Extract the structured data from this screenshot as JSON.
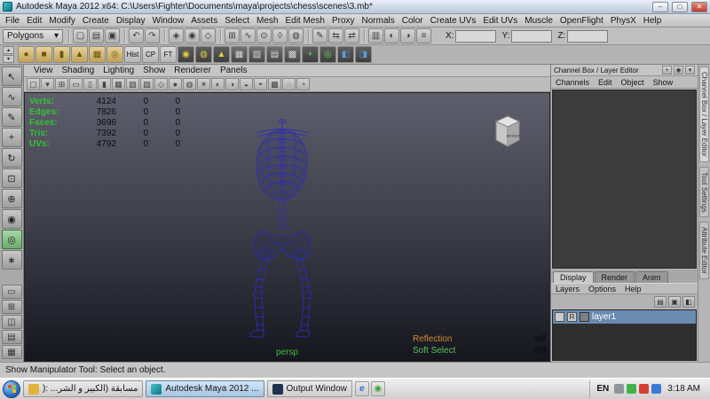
{
  "titlebar": {
    "title": "Autodesk Maya 2012 x64: C:\\Users\\Fighter\\Documents\\maya\\projects\\chess\\scenes\\3.mb*",
    "window_buttons": {
      "minimize": "–",
      "maximize": "□",
      "close": "✕"
    }
  },
  "menubar": {
    "items": [
      "File",
      "Edit",
      "Modify",
      "Create",
      "Display",
      "Window",
      "Assets",
      "Select",
      "Mesh",
      "Edit Mesh",
      "Proxy",
      "Normals",
      "Color",
      "Create UVs",
      "Edit UVs",
      "Muscle",
      "OpenFlight",
      "PhysX",
      "Help"
    ]
  },
  "statusline": {
    "mode_selector": "Polygons",
    "dropdown_arrow": "▾",
    "icons": [
      {
        "name": "new-scene-icon",
        "glyph": "▢",
        "cls": "gs"
      },
      {
        "name": "open-scene-icon",
        "glyph": "▤"
      },
      {
        "name": "save-scene-icon",
        "glyph": "▣"
      },
      {
        "name": "undo-icon",
        "glyph": "↶",
        "cls": "gs"
      },
      {
        "name": "redo-icon",
        "glyph": "↷"
      },
      {
        "name": "select-hierarchy-icon",
        "glyph": "◈",
        "cls": "gs"
      },
      {
        "name": "select-object-icon",
        "glyph": "◉"
      },
      {
        "name": "select-component-icon",
        "glyph": "◇"
      },
      {
        "name": "snap-to-grid-icon",
        "glyph": "⊞",
        "cls": "gs"
      },
      {
        "name": "snap-to-curve-icon",
        "glyph": "∿"
      },
      {
        "name": "snap-to-point-icon",
        "glyph": "⊙"
      },
      {
        "name": "snap-to-plane-icon",
        "glyph": "◊"
      },
      {
        "name": "make-live-icon",
        "glyph": "◍"
      },
      {
        "name": "construction-history-icon",
        "glyph": "✎",
        "cls": "gs"
      },
      {
        "name": "input-connections-icon",
        "glyph": "⇆"
      },
      {
        "name": "output-connections-icon",
        "glyph": "⇄"
      },
      {
        "name": "render-view-icon",
        "glyph": "▥",
        "cls": "gs"
      },
      {
        "name": "render-current-frame-icon",
        "glyph": "◐"
      },
      {
        "name": "ipr-render-icon",
        "glyph": "◑"
      },
      {
        "name": "render-settings-icon",
        "glyph": "≡"
      }
    ],
    "axis_fields": [
      {
        "label": "X:",
        "name": "x-coordinate-input"
      },
      {
        "label": "Y:",
        "name": "y-coordinate-input"
      },
      {
        "label": "Z:",
        "name": "z-coordinate-input"
      }
    ]
  },
  "shelf": {
    "tab_up": "▴",
    "tab_down": "▾",
    "icons": [
      {
        "name": "poly-sphere-icon",
        "glyph": "●",
        "cls": "tan"
      },
      {
        "name": "poly-cube-icon",
        "glyph": "■",
        "cls": "tan"
      },
      {
        "name": "poly-cylinder-icon",
        "glyph": "▮",
        "cls": "tan"
      },
      {
        "name": "poly-cone-icon",
        "glyph": "▲",
        "cls": "tan"
      },
      {
        "name": "poly-plane-icon",
        "glyph": "▦",
        "cls": "tan"
      },
      {
        "name": "poly-torus-icon",
        "glyph": "◎",
        "cls": "tan"
      },
      {
        "name": "history-toggle-button",
        "glyph": "Hist",
        "cls": "chip"
      },
      {
        "name": "cp-button",
        "glyph": "CP",
        "cls": "chip"
      },
      {
        "name": "ft-button",
        "glyph": "FT",
        "cls": "chip"
      },
      {
        "name": "sculpt-geometry-icon",
        "glyph": "◉",
        "cls": "yellow"
      },
      {
        "name": "smooth-mesh-icon",
        "glyph": "◍",
        "cls": "yellow"
      },
      {
        "name": "extrude-icon",
        "glyph": "▲",
        "cls": "yellow"
      },
      {
        "name": "combine-icon",
        "glyph": "▦",
        "cls": "dark"
      },
      {
        "name": "separate-icon",
        "glyph": "▧",
        "cls": "dark"
      },
      {
        "name": "merge-vertices-icon",
        "glyph": "▤",
        "cls": "dark"
      },
      {
        "name": "split-polygon-icon",
        "glyph": "▩",
        "cls": "dark"
      },
      {
        "name": "append-polygon-icon",
        "glyph": "+",
        "cls": "green"
      },
      {
        "name": "bridge-icon",
        "glyph": "◎",
        "cls": "green"
      },
      {
        "name": "mirror-geometry-icon",
        "glyph": "◧",
        "cls": "blue"
      },
      {
        "name": "boolean-icon",
        "glyph": "◨",
        "cls": "blue"
      }
    ]
  },
  "toolbox": {
    "tools": [
      {
        "name": "select-tool",
        "glyph": "↖"
      },
      {
        "name": "lasso-tool",
        "glyph": "∿"
      },
      {
        "name": "paint-select-tool",
        "glyph": "✎"
      },
      {
        "name": "move-tool",
        "glyph": "+"
      },
      {
        "name": "rotate-tool",
        "glyph": "↻"
      },
      {
        "name": "scale-tool",
        "glyph": "⊡"
      },
      {
        "name": "universal-manipulator-tool",
        "glyph": "⊕"
      },
      {
        "name": "soft-modification-tool",
        "glyph": "◉"
      },
      {
        "name": "show-manipulator-tool",
        "glyph": "◎",
        "cls": "active"
      },
      {
        "name": "last-tool-used",
        "glyph": "∗"
      }
    ],
    "layouts": [
      {
        "name": "single-pane-layout-button",
        "glyph": "▭"
      },
      {
        "name": "four-pane-layout-button",
        "glyph": "⊞"
      },
      {
        "name": "persp-outliner-layout-button",
        "glyph": "◫"
      },
      {
        "name": "persp-graph-layout-button",
        "glyph": "▤"
      },
      {
        "name": "hypershade-layout-button",
        "glyph": "▦"
      }
    ]
  },
  "panel": {
    "menu": [
      "View",
      "Shading",
      "Lighting",
      "Show",
      "Renderer",
      "Panels"
    ],
    "toolbar_icons": [
      {
        "name": "camera-attributes-icon",
        "glyph": "▢"
      },
      {
        "name": "bookmarks-icon",
        "glyph": "▾"
      },
      {
        "name": "grid-toggle-icon",
        "glyph": "⊞"
      },
      {
        "name": "film-gate-icon",
        "glyph": "▭"
      },
      {
        "name": "resolution-gate-icon",
        "glyph": "▯"
      },
      {
        "name": "gate-mask-icon",
        "glyph": "▮"
      },
      {
        "name": "field-chart-icon",
        "glyph": "▦"
      },
      {
        "name": "safe-action-icon",
        "glyph": "▧"
      },
      {
        "name": "safe-title-icon",
        "glyph": "▨"
      },
      {
        "name": "wireframe-mode-icon",
        "glyph": "◇"
      },
      {
        "name": "shaded-mode-icon",
        "glyph": "●"
      },
      {
        "name": "textured-mode-icon",
        "glyph": "◍"
      },
      {
        "name": "use-all-lights-icon",
        "glyph": "☀"
      },
      {
        "name": "shadows-icon",
        "glyph": "◐"
      },
      {
        "name": "xray-icon",
        "glyph": "◑"
      },
      {
        "name": "exposure-icon",
        "glyph": "◒"
      },
      {
        "name": "gamma-icon",
        "glyph": "◓"
      },
      {
        "name": "rgb-channels-icon",
        "glyph": "▩"
      },
      {
        "name": "alpha-channel-icon",
        "glyph": "◌"
      },
      {
        "name": "isolate-select-icon",
        "glyph": "◔"
      }
    ]
  },
  "hud": {
    "rows": [
      {
        "name": "hud-verts",
        "label": "Verts:",
        "value": "4124",
        "sel": "0",
        "other": "0"
      },
      {
        "name": "hud-edges",
        "label": "Edges:",
        "value": "7826",
        "sel": "0",
        "other": "0"
      },
      {
        "name": "hud-faces",
        "label": "Faces:",
        "value": "3696",
        "sel": "0",
        "other": "0"
      },
      {
        "name": "hud-tris",
        "label": "Tris:",
        "value": "7392",
        "sel": "0",
        "other": "0"
      },
      {
        "name": "hud-uvs",
        "label": "UVs:",
        "value": "4792",
        "sel": "0",
        "other": "0"
      }
    ]
  },
  "viewport": {
    "camera_label": "persp",
    "viewcube_face": "FRONT",
    "overlays": [
      {
        "name": "reflection-hud",
        "label": "Reflection",
        "value": "off",
        "cls": "ov1"
      },
      {
        "name": "soft-select-hud",
        "label": "Soft Select",
        "value": "off",
        "cls": "ov2"
      }
    ]
  },
  "channel_box": {
    "header": "Channel Box / Layer Editor",
    "header_icons": [
      {
        "name": "channel-manip-icon",
        "glyph": "+"
      },
      {
        "name": "channel-speed-icon",
        "glyph": "◉"
      },
      {
        "name": "channel-options-icon",
        "glyph": "▾"
      }
    ],
    "menu": [
      "Channels",
      "Edit",
      "Object",
      "Show"
    ]
  },
  "layer_editor": {
    "tabs": [
      {
        "label": "Display",
        "cls": "active"
      },
      {
        "label": "Render"
      },
      {
        "label": "Anim"
      }
    ],
    "menu": [
      "Layers",
      "Options",
      "Help"
    ],
    "icons": [
      {
        "name": "empty-layer-icon",
        "glyph": "▤"
      },
      {
        "name": "new-layer-icon",
        "glyph": "▣"
      },
      {
        "name": "new-layer-from-selected-icon",
        "glyph": "◧"
      }
    ],
    "layer": {
      "visibility": "",
      "mode": "R",
      "name": "layer1"
    }
  },
  "side_tabs": [
    {
      "label": "Channel Box / Layer Editor",
      "cls": "active"
    },
    {
      "label": "Tool Settings"
    },
    {
      "label": "Attribute Editor"
    }
  ],
  "help_line": "Show Manipulator Tool: Select an object.",
  "taskbar": {
    "tasks": [
      {
        "label": "مسابقة (الكبير و الشر... :(",
        "cls": "t1"
      },
      {
        "label": "Autodesk Maya 2012 ...",
        "cls": "t2 active"
      },
      {
        "label": "Output Window",
        "cls": "t3"
      }
    ],
    "quick_icons": [
      {
        "name": "internet-explorer-icon",
        "glyph": "e",
        "cls": "qblue"
      },
      {
        "name": "messenger-launcher-icon",
        "glyph": "◉",
        "cls": "qgreen"
      }
    ],
    "tray": {
      "lang": "EN",
      "icons": [
        {
          "name": "volume-icon",
          "cls": "gray"
        },
        {
          "name": "messenger-tray-icon",
          "cls": "green"
        },
        {
          "name": "antivirus-tray-icon",
          "cls": "red"
        },
        {
          "name": "network-tray-icon",
          "cls": "blue"
        }
      ],
      "time": "3:18 AM"
    }
  },
  "colors": {
    "viewport_top": "#5e5e6c",
    "viewport_bottom": "#16161e",
    "wireframe_blue": "#2d2db8",
    "hud_label_green": "#35c135",
    "layer_selection_blue": "#6a8cb0"
  }
}
